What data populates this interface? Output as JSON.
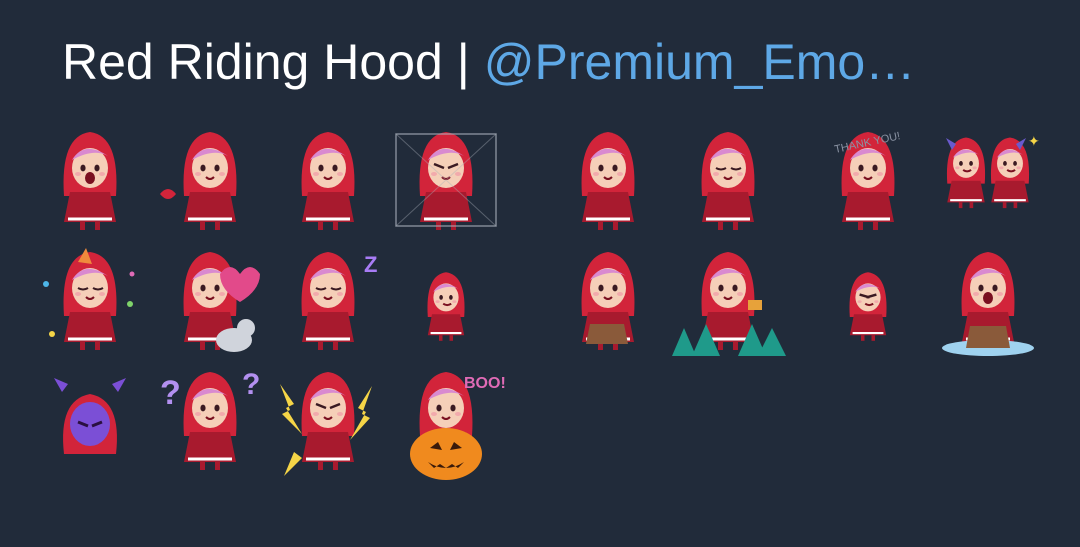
{
  "header": {
    "title": "Red Riding Hood",
    "separator": "|",
    "author_link": "@Premium_Emo…"
  },
  "colors": {
    "background": "#212b3a",
    "title": "#ffffff",
    "link": "#5ea8e6",
    "hood": "#d2243a",
    "hood_dark": "#a81a2e",
    "hair": "#d98ad0",
    "skin": "#f5cfb8"
  },
  "stickers": [
    {
      "name": "sticker-laughing-sitting"
    },
    {
      "name": "sticker-kiss"
    },
    {
      "name": "sticker-smile-standing"
    },
    {
      "name": "sticker-trapped-in-box"
    },
    {
      "name": "sticker-pointing"
    },
    {
      "name": "sticker-side-profile"
    },
    {
      "name": "sticker-thank-you",
      "text": "THANK YOU!"
    },
    {
      "name": "sticker-two-devil-horns"
    },
    {
      "name": "sticker-party-confetti"
    },
    {
      "name": "sticker-heart-cat"
    },
    {
      "name": "sticker-yawning-sleepy",
      "text": "Z"
    },
    {
      "name": "sticker-small-standing"
    },
    {
      "name": "sticker-sitting-on-stump"
    },
    {
      "name": "sticker-forest-basket"
    },
    {
      "name": "sticker-tiny-angry"
    },
    {
      "name": "sticker-crying-on-stump"
    },
    {
      "name": "sticker-purple-devil"
    },
    {
      "name": "sticker-confused-question-marks"
    },
    {
      "name": "sticker-angry-lightning"
    },
    {
      "name": "sticker-halloween-pumpkin",
      "text": "BOO!"
    }
  ]
}
